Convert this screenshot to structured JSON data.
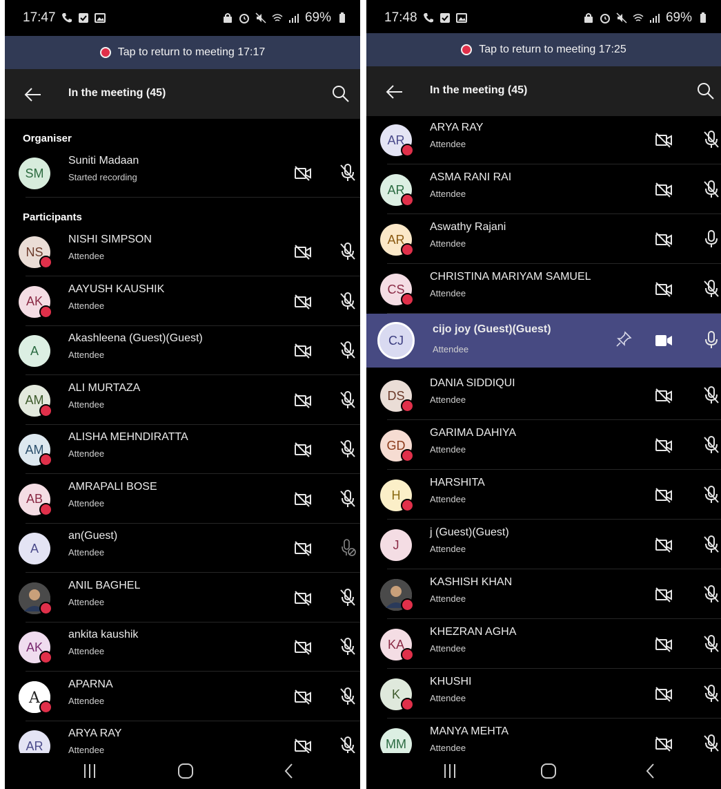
{
  "left": {
    "status": {
      "time": "17:47",
      "battery": "69%"
    },
    "banner": {
      "text": "Tap to return to meeting 17:17"
    },
    "header": {
      "title": "In the meeting (45)"
    },
    "sections": {
      "organiser": "Organiser",
      "participants": "Participants"
    },
    "organiser": {
      "initials": "SM",
      "name": "Suniti Madaan",
      "role": "Started recording",
      "bg": "#d7ecdc",
      "fg": "#2c6b3f"
    },
    "participants": [
      {
        "initials": "NS",
        "name": "NISHI SIMPSON",
        "role": "Attendee",
        "bg": "#eaddd6",
        "fg": "#6b3a2a",
        "dot": true,
        "mic": "muted"
      },
      {
        "initials": "AK",
        "name": "AAYUSH KAUSHIK",
        "role": "Attendee",
        "bg": "#f4dde4",
        "fg": "#8a2a45",
        "dot": true,
        "mic": "muted"
      },
      {
        "initials": "A",
        "name": "Akashleena (Guest)(Guest)",
        "role": "Attendee",
        "bg": "#dcefe3",
        "fg": "#2b6b42",
        "dot": false,
        "mic": "muted"
      },
      {
        "initials": "AM",
        "name": "ALI MURTAZA",
        "role": "Attendee",
        "bg": "#e3e9dd",
        "fg": "#3d5a2b",
        "dot": true,
        "mic": "muted"
      },
      {
        "initials": "AM",
        "name": "ALISHA MEHNDIRATTA",
        "role": "Attendee",
        "bg": "#dde8ef",
        "fg": "#2b4f6b",
        "dot": true,
        "mic": "muted"
      },
      {
        "initials": "AB",
        "name": "AMRAPALI BOSE",
        "role": "Attendee",
        "bg": "#f4dde4",
        "fg": "#8a2a45",
        "dot": true,
        "mic": "muted"
      },
      {
        "initials": "A",
        "name": "an(Guest)",
        "role": "Attendee",
        "bg": "#e4e4f4",
        "fg": "#4a4a8a",
        "dot": false,
        "mic": "disabled"
      },
      {
        "initials": "",
        "name": "ANIL  BAGHEL",
        "role": "Attendee",
        "bg": "#5a5a5a",
        "fg": "#fff",
        "dot": true,
        "mic": "muted",
        "photo": true
      },
      {
        "initials": "AK",
        "name": "ankita kaushik",
        "role": "Attendee",
        "bg": "#f0dcef",
        "fg": "#7a2a70",
        "dot": true,
        "mic": "muted"
      },
      {
        "initials": "",
        "name": "APARNA",
        "role": "Attendee",
        "bg": "#ffffff",
        "fg": "#000",
        "dot": true,
        "mic": "muted",
        "logo": true
      },
      {
        "initials": "AR",
        "name": "ARYA RAY",
        "role": "Attendee",
        "bg": "#e4e4f4",
        "fg": "#4a4a8a",
        "dot": false,
        "mic": "muted"
      }
    ]
  },
  "right": {
    "status": {
      "time": "17:48",
      "battery": "69%"
    },
    "banner": {
      "text": "Tap to return to meeting 17:25"
    },
    "header": {
      "title": "In the meeting (45)"
    },
    "participants": [
      {
        "initials": "AR",
        "name": "ARYA RAY",
        "role": "Attendee",
        "bg": "#e4e4f4",
        "fg": "#4a4a8a",
        "dot": true,
        "mic": "muted"
      },
      {
        "initials": "AR",
        "name": "ASMA RANI RAI",
        "role": "Attendee",
        "bg": "#dcefe3",
        "fg": "#2b6b42",
        "dot": true,
        "mic": "muted"
      },
      {
        "initials": "AR",
        "name": "Aswathy Rajani",
        "role": "Attendee",
        "bg": "#fbe8c8",
        "fg": "#8a5a12",
        "dot": true,
        "mic": "on"
      },
      {
        "initials": "CS",
        "name": "CHRISTINA MARIYAM SAMUEL",
        "role": "Attendee",
        "bg": "#f4dde4",
        "fg": "#8a2a45",
        "dot": true,
        "mic": "muted"
      },
      {
        "initials": "CJ",
        "name": "cijo joy (Guest)(Guest)",
        "role": "Attendee",
        "bg": "#d9daf1",
        "fg": "#3b3d80",
        "dot": false,
        "mic": "on",
        "selected": true
      },
      {
        "initials": "DS",
        "name": "DANIA SIDDIQUI",
        "role": "Attendee",
        "bg": "#eaddd6",
        "fg": "#6b3a2a",
        "dot": true,
        "mic": "muted"
      },
      {
        "initials": "GD",
        "name": "GARIMA DAHIYA",
        "role": "Attendee",
        "bg": "#f6dcd2",
        "fg": "#8a3a1a",
        "dot": true,
        "mic": "muted"
      },
      {
        "initials": "H",
        "name": "HARSHITA",
        "role": "Attendee",
        "bg": "#fbefc8",
        "fg": "#8a6a12",
        "dot": true,
        "mic": "muted"
      },
      {
        "initials": "J",
        "name": "j (Guest)(Guest)",
        "role": "Attendee",
        "bg": "#f4dde4",
        "fg": "#8a2a45",
        "dot": false,
        "mic": "muted"
      },
      {
        "initials": "",
        "name": "KASHISH  KHAN",
        "role": "Attendee",
        "bg": "#8a8a8a",
        "fg": "#fff",
        "dot": true,
        "mic": "muted",
        "photo": true
      },
      {
        "initials": "KA",
        "name": "KHEZRAN AGHA",
        "role": "Attendee",
        "bg": "#f4dde4",
        "fg": "#8a2a45",
        "dot": true,
        "mic": "muted"
      },
      {
        "initials": "K",
        "name": "KHUSHI",
        "role": "Attendee",
        "bg": "#dfe9dc",
        "fg": "#3d5a2b",
        "dot": true,
        "mic": "muted"
      },
      {
        "initials": "MM",
        "name": "MANYA MEHTA",
        "role": "Attendee",
        "bg": "#dcefe3",
        "fg": "#2b6b42",
        "dot": false,
        "mic": "muted"
      }
    ]
  },
  "colors": {
    "banner": "#313a55",
    "header": "#1f1f1f",
    "selected": "#474a82",
    "presence_dot": "#e0304a"
  }
}
